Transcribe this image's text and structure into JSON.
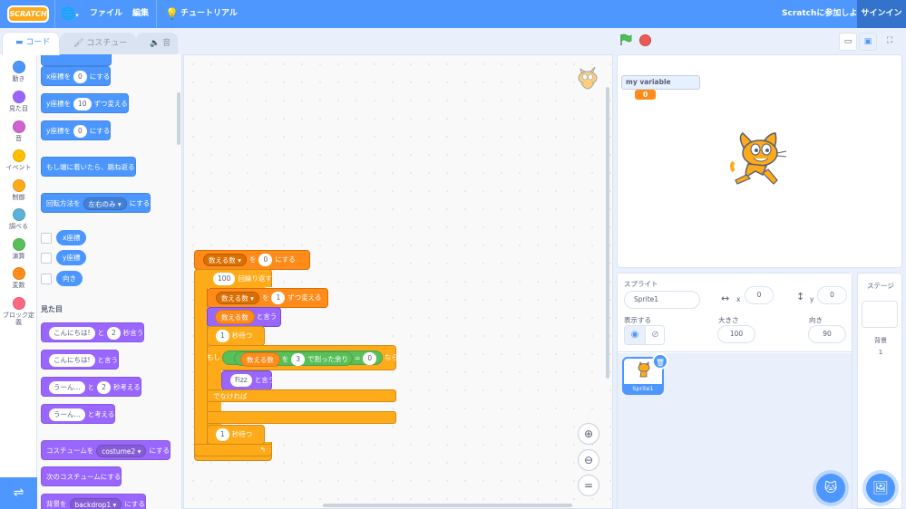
{
  "menubar": {
    "logo_text": "SCRATCH",
    "file": "ファイル",
    "edit": "編集",
    "tutorial": "チュートリアル",
    "join": "Scratchに参加しよう",
    "signin": "サインイン"
  },
  "tabs": {
    "code": "コード",
    "costume": "コスチューム",
    "sound": "音"
  },
  "categories": [
    {
      "label": "動き",
      "color": "#4c97ff"
    },
    {
      "label": "見た目",
      "color": "#9966ff"
    },
    {
      "label": "音",
      "color": "#cf63cf"
    },
    {
      "label": "イベント",
      "color": "#ffbf00"
    },
    {
      "label": "制御",
      "color": "#ffab19"
    },
    {
      "label": "調べる",
      "color": "#5cb1d6"
    },
    {
      "label": "演算",
      "color": "#59c059"
    },
    {
      "label": "変数",
      "color": "#ff8c1a"
    },
    {
      "label": "ブロック定義",
      "color": "#ff6680"
    }
  ],
  "palette": {
    "setx": {
      "pre": "x座標を",
      "val": "0",
      "post": "にする"
    },
    "changey": {
      "pre": "y座標を",
      "val": "10",
      "post": "ずつ変える"
    },
    "sety": {
      "pre": "y座標を",
      "val": "0",
      "post": "にする"
    },
    "bounce": "もし端に着いたら、跳ね返る",
    "rotation": {
      "pre": "回転方法を",
      "dd": "左右のみ",
      "post": "にする"
    },
    "rep_x": "x座標",
    "rep_y": "y座標",
    "rep_dir": "向き",
    "looks_title": "見た目",
    "sayfor": {
      "pre": "",
      "text": "こんにちは!",
      "mid": "と",
      "secs": "2",
      "post": "秒言う"
    },
    "say": {
      "text": "こんにちは!",
      "post": "と言う"
    },
    "thinkfor": {
      "text": "うーん...",
      "mid": "と",
      "secs": "2",
      "post": "秒考える"
    },
    "think": {
      "text": "うーん...",
      "post": "と考える"
    },
    "switchcostume": {
      "pre": "コスチュームを",
      "dd": "costume2",
      "post": "にする"
    },
    "nextcostume": "次のコスチュームにする",
    "switchbackdrop": {
      "pre": "背景を",
      "dd": "backdrop1",
      "post": "にする"
    }
  },
  "script": {
    "b1": {
      "var": "数える数",
      "mid": "を",
      "val": "0",
      "post": "にする"
    },
    "b2": {
      "count": "100",
      "post": "回繰り返す"
    },
    "b3": {
      "var": "数える数",
      "mid": "を",
      "val": "1",
      "post": "ずつ変える"
    },
    "b4": {
      "rep": "数える数",
      "post": "と言う"
    },
    "b5": {
      "val": "1",
      "post": "秒待つ"
    },
    "b6": {
      "if": "もし",
      "rep": "数える数",
      "wo": "を",
      "div": "3",
      "mod": "で割った余り",
      "eq": "=",
      "rhs": "0",
      "then": "なら"
    },
    "b7": {
      "text": "Fizz",
      "post": "と言う"
    },
    "b8": "でなければ",
    "b9": {
      "val": "1",
      "post": "秒待つ"
    }
  },
  "stage": {
    "var_name": "my variable",
    "var_value": "0"
  },
  "sprite_info": {
    "sprite_label": "スプライト",
    "sprite_name": "Sprite1",
    "x_label": "x",
    "x": "0",
    "y_label": "y",
    "y": "0",
    "show_label": "表示する",
    "size_label": "大きさ",
    "size": "100",
    "dir_label": "向き",
    "direction": "90"
  },
  "sprite_tile_name": "Sprite1",
  "stage_pane": {
    "title": "ステージ",
    "backdrops_label": "背景",
    "backdrops_count": "1"
  }
}
